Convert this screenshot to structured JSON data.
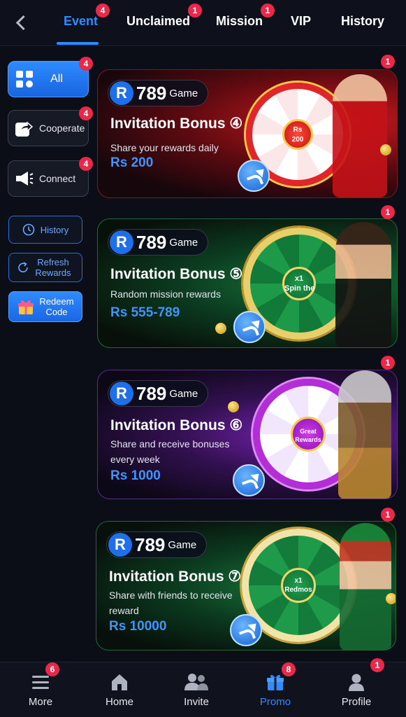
{
  "tabs": [
    {
      "label": "Event",
      "badge": "4",
      "active": true
    },
    {
      "label": "Unclaimed",
      "badge": "1"
    },
    {
      "label": "Mission",
      "badge": "1"
    },
    {
      "label": "VIP"
    },
    {
      "label": "History"
    }
  ],
  "sidebar": {
    "categories": [
      {
        "label": "All",
        "badge": "4",
        "icon": "grid-icon"
      },
      {
        "label": "Cooperate",
        "badge": "4",
        "icon": "share-icon"
      },
      {
        "label": "Connect",
        "badge": "4",
        "icon": "megaphone-icon"
      }
    ],
    "actions": [
      {
        "label": "History",
        "icon": "clock-icon"
      },
      {
        "label": "Refresh Rewards",
        "icon": "refresh-icon"
      },
      {
        "label": "Redeem Code",
        "icon": "gift-icon"
      }
    ]
  },
  "cards": [
    {
      "brand_num": "789",
      "brand_game": "Game",
      "brand_r": "R",
      "title": "Invitation Bonus ④",
      "desc": "Share your rewards daily",
      "amount": "Rs 200",
      "badge": "1",
      "hub_text": "Rs\n200",
      "theme": "#c0141b"
    },
    {
      "brand_num": "789",
      "brand_game": "Game",
      "brand_r": "R",
      "title": "Invitation Bonus ⑤",
      "desc": "Random mission rewards",
      "amount": "Rs 555-789",
      "badge": "1",
      "hub_text": "x1\nSpin the",
      "theme": "#0f6d35"
    },
    {
      "brand_num": "789",
      "brand_game": "Game",
      "brand_r": "R",
      "title": "Invitation Bonus ⑥",
      "desc": "Share and receive bonuses every week",
      "amount": "Rs 1000",
      "badge": "1",
      "hub_text": "Great\nRewards",
      "theme": "#8e1fc4"
    },
    {
      "brand_num": "789",
      "brand_game": "Game",
      "brand_r": "R",
      "title": "Invitation Bonus ⑦",
      "desc": "Share with friends to receive reward",
      "amount": "Rs 10000",
      "badge": "1",
      "hub_text": "x1\nRedmos",
      "theme": "#1a7a3a"
    }
  ],
  "nav": [
    {
      "label": "More",
      "badge": "6",
      "icon": "menu-icon"
    },
    {
      "label": "Home",
      "icon": "home-icon"
    },
    {
      "label": "Invite",
      "icon": "people-icon"
    },
    {
      "label": "Promo",
      "badge": "8",
      "icon": "gift-icon",
      "active": true
    },
    {
      "label": "Profile",
      "badge": "1",
      "icon": "user-icon"
    }
  ],
  "colors": {
    "accent": "#2f8bff",
    "badge": "#e9284a",
    "background": "#0b0e17"
  }
}
